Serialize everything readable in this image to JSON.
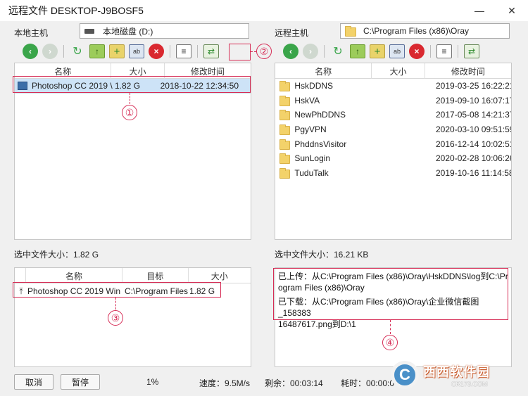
{
  "window": {
    "title": "远程文件 DESKTOP-J9BOSF5",
    "minimize": "—",
    "close": "✕"
  },
  "local": {
    "host_label": "本地主机",
    "path": "本地磁盘 (D:)",
    "columns": [
      "名称",
      "大小",
      "修改时间"
    ],
    "files": [
      {
        "name": "Photoshop CC 2019 \\",
        "size": "1.82 G",
        "modified": "2018-10-22 12:34:50"
      }
    ],
    "selected_size_label": "选中文件大小：1.82 G"
  },
  "remote": {
    "host_label": "远程主机",
    "path": "C:\\Program Files (x86)\\Oray",
    "columns": [
      "名称",
      "大小",
      "修改时间"
    ],
    "files": [
      {
        "name": "HskDDNS",
        "size": "",
        "modified": "2019-03-25 16:22:21"
      },
      {
        "name": "HskVA",
        "size": "",
        "modified": "2019-09-10 16:07:17"
      },
      {
        "name": "NewPhDDNS",
        "size": "",
        "modified": "2017-05-08 14:21:37"
      },
      {
        "name": "PgyVPN",
        "size": "",
        "modified": "2020-03-10 09:51:59"
      },
      {
        "name": "PhddnsVisitor",
        "size": "",
        "modified": "2016-12-14 10:02:51"
      },
      {
        "name": "SunLogin",
        "size": "",
        "modified": "2020-02-28 10:06:26"
      },
      {
        "name": "TuduTalk",
        "size": "",
        "modified": "2019-10-16 11:14:58"
      }
    ],
    "selected_size_label": "选中文件大小：16.21 KB"
  },
  "transfer": {
    "columns": [
      "名称",
      "目标",
      "大小"
    ],
    "items": [
      {
        "name": "Photoshop CC 2019 Win",
        "target": "C:\\Program Files",
        "size": "1.82 G"
      }
    ]
  },
  "log": {
    "lines": [
      "已上传：从C:\\Program Files (x86)\\Oray\\HskDDNS\\log到C:\\Pr",
      "ogram Files (x86)\\Oray",
      "已下载：从C:\\Program Files (x86)\\Oray\\企业微信截图_158383",
      "16487617.png到D:\\1"
    ]
  },
  "annotations": [
    "①",
    "②",
    "③",
    "④"
  ],
  "bottom": {
    "cancel": "取消",
    "pause": "暂停",
    "progress": "1%",
    "speed": "速度：9.5M/s",
    "remaining": "剩余：00:03:14",
    "elapsed": "耗时：00:00:0"
  },
  "watermark": {
    "logo": "C",
    "main": "西西软件园",
    "sub": "CR173.COM"
  },
  "colors": {
    "annotation": "#d62d56",
    "green": "#3aa54a",
    "red": "#d9282f"
  }
}
